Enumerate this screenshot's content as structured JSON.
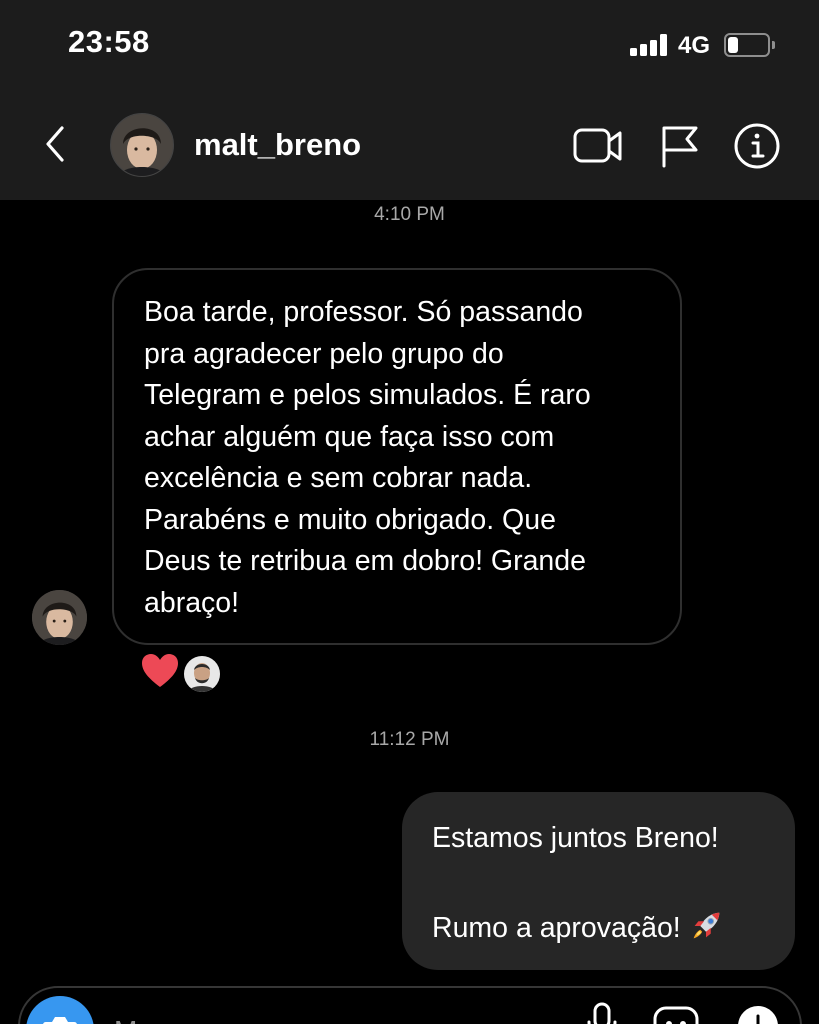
{
  "status_bar": {
    "time": "23:58",
    "network": "4G",
    "signal_bars": 4,
    "battery_level": 0.25
  },
  "header": {
    "username": "malt_breno",
    "icons": [
      "back-chevron-icon",
      "video-call-icon",
      "flag-icon",
      "info-icon"
    ]
  },
  "chat": {
    "messages": [
      {
        "timestamp": "4:10 PM",
        "direction": "incoming",
        "text": "Boa tarde, professor. Só passando\npra agradecer pelo grupo do\nTelegram e pelos simulados. É raro\nachar alguém que faça isso com\nexcelência e sem cobrar nada.\nParabéns e muito obrigado. Que\nDeus te retribua em dobro! Grande\nabraço!",
        "reaction": "heart-icon"
      },
      {
        "timestamp": "11:12 PM",
        "direction": "outgoing",
        "line1": "Estamos juntos Breno!",
        "line2": "Rumo a aprovação!",
        "emoji": "rocket-icon"
      }
    ]
  },
  "composer": {
    "placeholder": "Message...",
    "icons": [
      "camera-icon",
      "microphone-icon",
      "sticker-icon",
      "add-icon"
    ]
  },
  "colors": {
    "header_bg": "#1c1c1c",
    "chat_bg": "#000000",
    "outgoing_bubble": "#262626",
    "incoming_border": "#2f2f2f",
    "timestamp": "#a8a8a8",
    "camera_button": "#3797f0",
    "heart": "#ed4956"
  }
}
